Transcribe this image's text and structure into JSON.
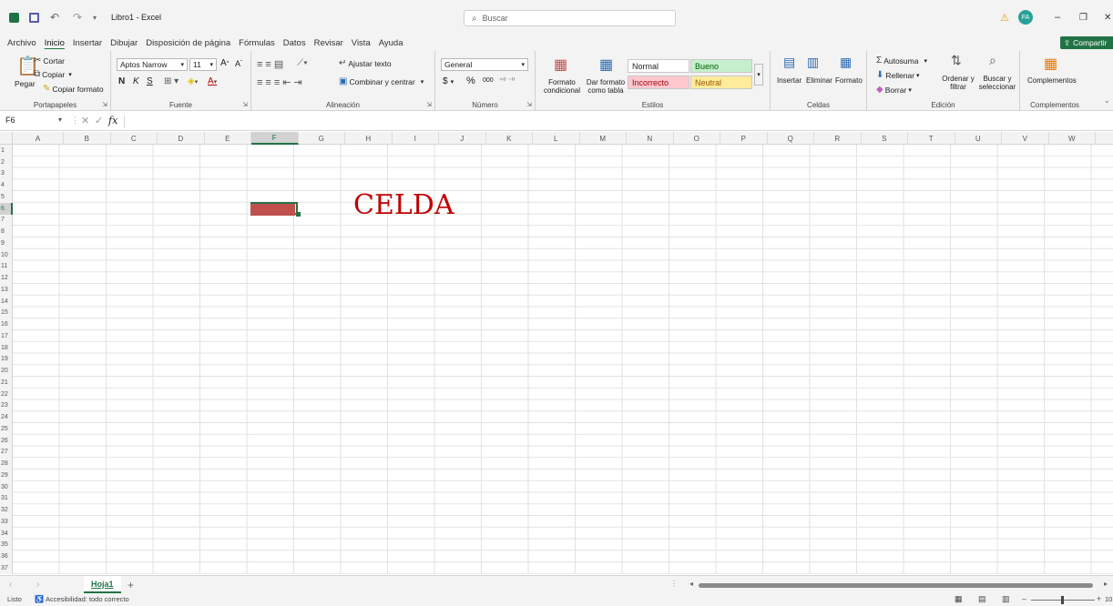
{
  "titlebar": {
    "undo_icon": "undo-icon",
    "redo_icon": "redo-icon",
    "document_title": "Libro1 - Excel",
    "search_placeholder": "Buscar",
    "user_initials": "FA",
    "warning_icon": "warning-icon"
  },
  "menu_tabs": [
    "Archivo",
    "Inicio",
    "Insertar",
    "Dibujar",
    "Disposición de página",
    "Fórmulas",
    "Datos",
    "Revisar",
    "Vista",
    "Ayuda"
  ],
  "share_button": "Compartir",
  "ribbon": {
    "clipboard": {
      "label": "Portapapeles",
      "paste": "Pegar",
      "cut": "Cortar",
      "copy": "Copiar",
      "format_painter": "Copiar formato"
    },
    "font": {
      "label": "Fuente",
      "font_name": "Aptos Narrow",
      "font_size": "11",
      "bold": "N",
      "italic": "K",
      "underline": "S"
    },
    "alignment": {
      "label": "Alineación",
      "wrap": "Ajustar texto",
      "merge": "Combinar y centrar"
    },
    "number": {
      "label": "Número",
      "format": "General",
      "currency": "$",
      "percent": "%",
      "thousands": "000"
    },
    "styles": {
      "label": "Estilos",
      "conditional": "Formato condicional",
      "as_table": "Dar formato como tabla",
      "normal": "Normal",
      "good": "Bueno",
      "bad": "Incorrecto",
      "neutral": "Neutral"
    },
    "cells": {
      "label": "Celdas",
      "insert": "Insertar",
      "delete": "Eliminar",
      "format": "Formato"
    },
    "editing": {
      "label": "Edición",
      "autosum": "Autosuma",
      "fill": "Rellenar",
      "clear": "Borrar",
      "sort": "Ordenar y filtrar",
      "find": "Buscar y seleccionar"
    },
    "addins": {
      "label": "Complementos",
      "button": "Complementos"
    }
  },
  "formula_bar": {
    "name_box": "F6",
    "fx": "fx",
    "value": ""
  },
  "columns": [
    "A",
    "B",
    "C",
    "D",
    "E",
    "F",
    "G",
    "H",
    "I",
    "J",
    "K",
    "L",
    "M",
    "N",
    "O",
    "P",
    "Q",
    "R",
    "S",
    "T",
    "U",
    "V",
    "W"
  ],
  "rows": [
    "1",
    "2",
    "3",
    "4",
    "5",
    "6",
    "7",
    "8",
    "9",
    "10",
    "11",
    "12",
    "13",
    "14",
    "15",
    "16",
    "17",
    "18",
    "19",
    "20",
    "21",
    "22",
    "23",
    "24",
    "25",
    "26",
    "27",
    "28",
    "29",
    "30",
    "31",
    "32",
    "33",
    "34",
    "35",
    "36",
    "37"
  ],
  "wordart_text": "CELDA",
  "sheet_tabs": [
    "Hoja1"
  ],
  "add_sheet": "+",
  "status": {
    "ready": "Listo",
    "accessibility": "Accesibilidad: todo correcto",
    "zoom": "10"
  },
  "colors": {
    "excel_green": "#217346",
    "shape_red": "#c0504d",
    "wordart_red": "#c00000",
    "good_bg": "#c6efce",
    "bad_bg": "#ffc7ce",
    "neutral_bg": "#ffeb9c"
  }
}
